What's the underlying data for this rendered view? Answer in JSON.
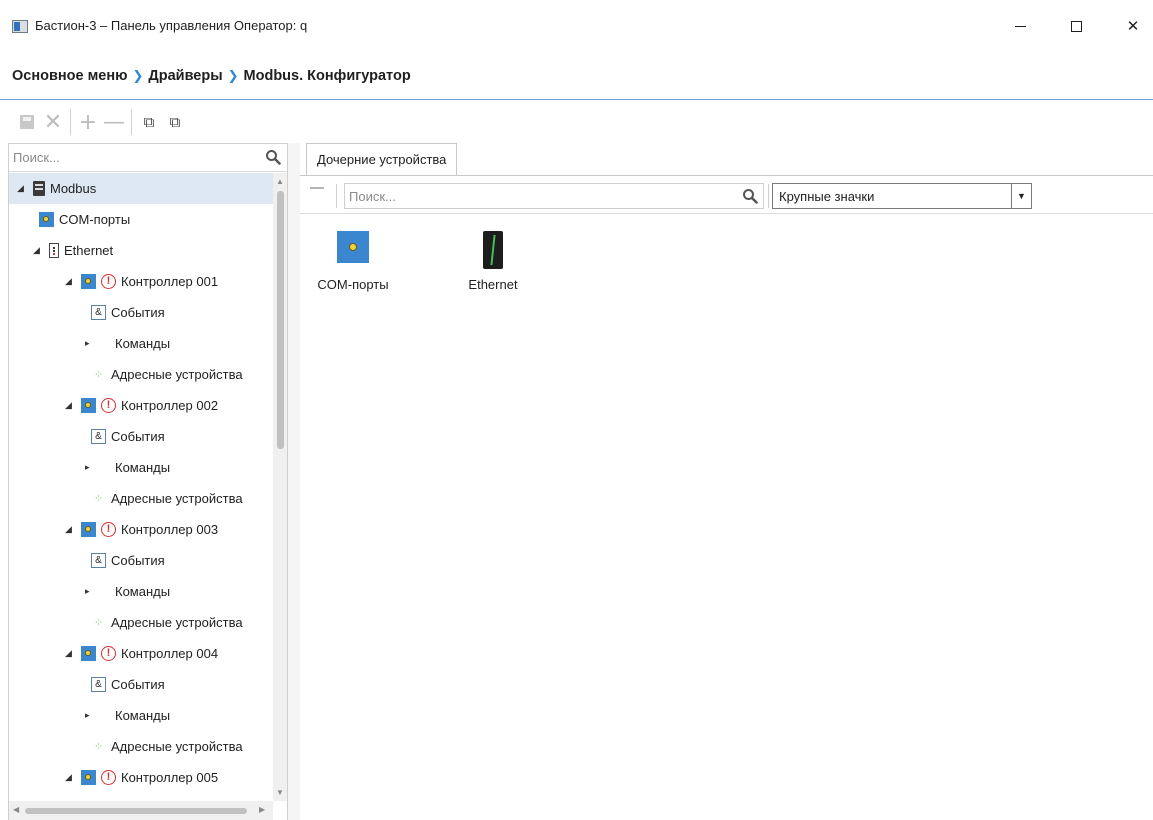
{
  "window": {
    "title": "Бастион-3 – Панель управления Оператор: q",
    "minimize": "—",
    "maximize": "☐",
    "close": "✕"
  },
  "breadcrumb": {
    "items": [
      "Основное меню",
      "Драйверы",
      "Modbus. Конфигуратор"
    ],
    "separator": "❯"
  },
  "toolbar": {
    "delete": "✕",
    "add": "+",
    "remove": "—",
    "layers1": "⧉",
    "layers2": "⧉"
  },
  "tree_search": {
    "placeholder": "Поиск..."
  },
  "tree": {
    "items": [
      {
        "label": "Modbus",
        "icon": "modbus-icon",
        "level": 0,
        "expander": "◢"
      },
      {
        "label": "COM-порты",
        "icon": "com-port-icon",
        "level": 1,
        "expander": ""
      },
      {
        "label": "Ethernet",
        "icon": "ethernet-icon",
        "level": 1,
        "expander": "◢"
      },
      {
        "label": "Контроллер 001",
        "icon": "controller-icon",
        "level": 2,
        "expander": "◢",
        "warning": true
      },
      {
        "label": "События",
        "icon": "events-icon",
        "level": 3,
        "expander": ""
      },
      {
        "label": "Команды",
        "icon": "",
        "level": 3,
        "expander": "▸"
      },
      {
        "label": "Адресные устройства",
        "icon": "address-devices-icon",
        "level": 3,
        "expander": ""
      },
      {
        "label": "Контроллер 002",
        "icon": "controller-icon",
        "level": 2,
        "expander": "◢",
        "warning": true
      },
      {
        "label": "События",
        "icon": "events-icon",
        "level": 3,
        "expander": ""
      },
      {
        "label": "Команды",
        "icon": "",
        "level": 3,
        "expander": "▸"
      },
      {
        "label": "Адресные устройства",
        "icon": "address-devices-icon",
        "level": 3,
        "expander": ""
      },
      {
        "label": "Контроллер 003",
        "icon": "controller-icon",
        "level": 2,
        "expander": "◢",
        "warning": true
      },
      {
        "label": "События",
        "icon": "events-icon",
        "level": 3,
        "expander": ""
      },
      {
        "label": "Команды",
        "icon": "",
        "level": 3,
        "expander": "▸"
      },
      {
        "label": "Адресные устройства",
        "icon": "address-devices-icon",
        "level": 3,
        "expander": ""
      },
      {
        "label": "Контроллер 004",
        "icon": "controller-icon",
        "level": 2,
        "expander": "◢",
        "warning": true
      },
      {
        "label": "События",
        "icon": "events-icon",
        "level": 3,
        "expander": ""
      },
      {
        "label": "Команды",
        "icon": "",
        "level": 3,
        "expander": "▸"
      },
      {
        "label": "Адресные устройства",
        "icon": "address-devices-icon",
        "level": 3,
        "expander": ""
      },
      {
        "label": "Контроллер 005",
        "icon": "controller-icon",
        "level": 2,
        "expander": "◢",
        "warning": true
      }
    ]
  },
  "tabs": [
    {
      "label": "Дочерние устройства",
      "active": true
    }
  ],
  "content_search": {
    "placeholder": "Поиск..."
  },
  "view_mode": {
    "selected": "Крупные значки"
  },
  "devices": [
    {
      "label": "COM-порты",
      "icon": "com-port-icon"
    },
    {
      "label": "Ethernet",
      "icon": "ethernet-icon"
    }
  ],
  "colors": {
    "accent": "#2f86d6",
    "selection": "#dde8f3",
    "warning": "#d32f2f",
    "address_green": "#76c043"
  }
}
